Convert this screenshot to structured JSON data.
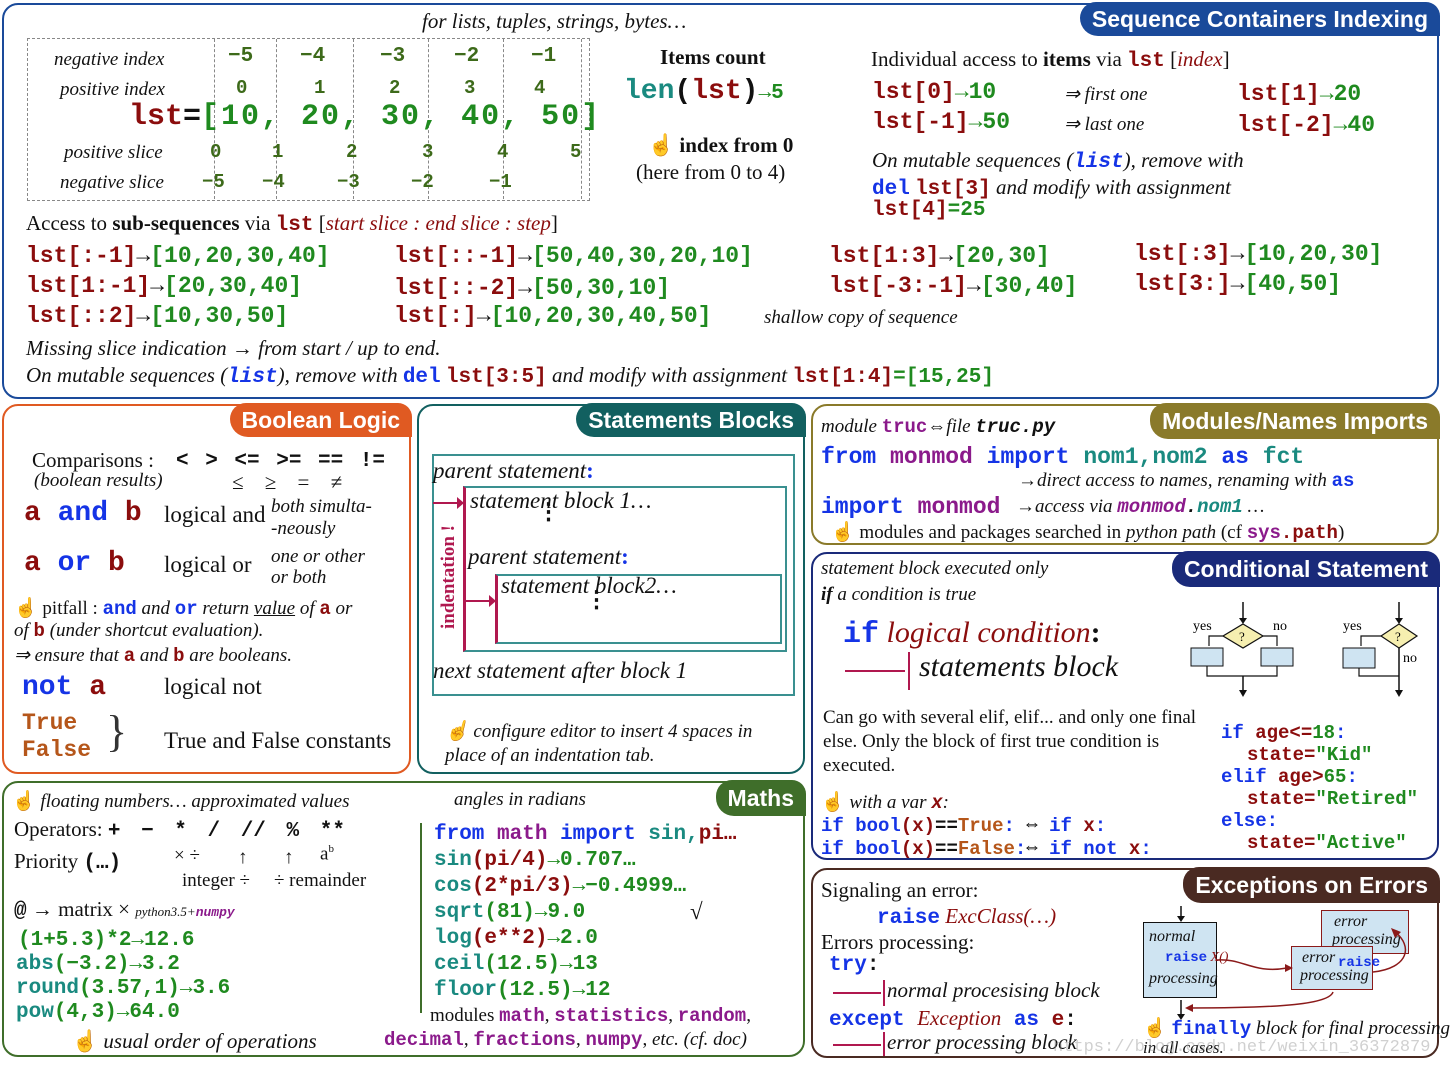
{
  "seq": {
    "title": "Sequence Containers Indexing",
    "subtitle": "for lists, tuples, strings, bytes…",
    "neg_index_label": "negative index",
    "pos_index_label": "positive index",
    "pos_slice_label": "positive slice",
    "neg_slice_label": "negative slice",
    "neg_index": [
      "−5",
      "−4",
      "−3",
      "−2",
      "−1"
    ],
    "pos_index": [
      "0",
      "1",
      "2",
      "3",
      "4"
    ],
    "pos_slice": [
      "0",
      "1",
      "2",
      "3",
      "4",
      "5"
    ],
    "neg_slice": [
      "−5",
      "−4",
      "−3",
      "−2",
      "−1"
    ],
    "lst_name": "lst",
    "lst_eq": "=",
    "lst_values": "[10, 20, 30, 40, 50]",
    "items_count_title": "Items count",
    "len_fn": "len",
    "len_open": "(",
    "len_arg": "lst",
    "len_close": ")",
    "len_result": "→5",
    "index_from_0": "index from 0",
    "index_range": "(here from 0 to 4)",
    "individual_access_prefix": "Individual access to ",
    "individual_access_bold": "items",
    "individual_access_via": " via ",
    "individual_access_index": "index",
    "access": [
      {
        "expr": "lst[0]",
        "res": "→10",
        "note": "⇒ first one"
      },
      {
        "expr": "lst[-1]",
        "res": "→50",
        "note": "⇒ last one"
      },
      {
        "expr": "lst[1]",
        "res": "→20"
      },
      {
        "expr": "lst[-2]",
        "res": "→40"
      }
    ],
    "mutable_text1": "On mutable sequences (",
    "mutable_list": "list",
    "mutable_text2": "), remove with",
    "del_kw": "del",
    "del_expr": "lst[3]",
    "modify_text": " and modify with assignment",
    "assign_expr": "lst[4]",
    "assign_val": "=25",
    "subseq_prefix": "Access to ",
    "subseq_bold": "sub-sequences",
    "subseq_via": " via ",
    "subseq_syntax": "start slice : end slice : step",
    "slices": [
      {
        "expr": "lst[:-1]",
        "res": "[10,20,30,40]"
      },
      {
        "expr": "lst[1:-1]",
        "res": "[20,30,40]"
      },
      {
        "expr": "lst[::2]",
        "res": "[10,30,50]"
      },
      {
        "expr": "lst[::-1]",
        "res": "[50,40,30,20,10]"
      },
      {
        "expr": "lst[::-2]",
        "res": "[50,30,10]"
      },
      {
        "expr": "lst[:]",
        "res": "[10,20,30,40,50]"
      },
      {
        "expr": "lst[1:3]",
        "res": "[20,30]"
      },
      {
        "expr": "lst[-3:-1]",
        "res": "[30,40]"
      },
      {
        "expr": "lst[:3]",
        "res": "[10,20,30]"
      },
      {
        "expr": "lst[3:]",
        "res": "[40,50]"
      }
    ],
    "shallow_copy": "shallow copy of sequence",
    "missing_slice": "Missing slice indication → from start / up to end.",
    "mutable2_text1": "On mutable sequences (",
    "mutable2_list": "list",
    "mutable2_text2": "), remove with ",
    "mutable2_del": "del",
    "mutable2_del_expr": "lst[3:5]",
    "mutable2_text3": " and modify with assignment ",
    "mutable2_assign": "lst[1:4]",
    "mutable2_val": "=[15,25]"
  },
  "bool": {
    "title": "Boolean Logic",
    "comparisons_label": "Comparisons :",
    "comparisons_ops": "< > <= >= == !=",
    "boolean_results": "(boolean results)",
    "math_ops": "≤  ≥  =  ≠",
    "and_a": "a",
    "and_kw": "and",
    "and_b": "b",
    "and_desc": "logical and",
    "and_note1": "both simulta-",
    "and_note2": "-neously",
    "or_a": "a",
    "or_kw": "or",
    "or_b": "b",
    "or_desc": "logical or",
    "or_note1": "one or other",
    "or_note2": "or both",
    "pitfall_label": "pitfall :",
    "pitfall_and": "and",
    "pitfall_mid": " and ",
    "pitfall_or": "or",
    "pitfall_return": " return ",
    "pitfall_value": "value",
    "pitfall_of": " of ",
    "pitfall_a": "a",
    "pitfall_or2": " or",
    "pitfall_line2_of": "of ",
    "pitfall_line2_b": "b",
    "pitfall_line2_rest": " (under shortcut evaluation).",
    "ensure_prefix": "⇒ ensure that ",
    "ensure_a": "a",
    "ensure_and": " and ",
    "ensure_b": "b",
    "ensure_rest": " are booleans.",
    "not_kw": "not",
    "not_a": "a",
    "not_desc": "logical not",
    "true_kw": "True",
    "false_kw": "False",
    "constants_desc": "True and False constants"
  },
  "blocks": {
    "title": "Statements Blocks",
    "parent1": "parent statement",
    "colon": ":",
    "block1": "statement block 1…",
    "parent2": "parent statement",
    "block2": "statement block2…",
    "next": "next statement after block 1",
    "indentation": "indentation !",
    "tip": "configure editor to insert 4 spaces in place of an indentation tab."
  },
  "modules": {
    "title": "Modules/Names Imports",
    "module_label": "module",
    "module_name": "truc",
    "file_label": "⇔file",
    "file_name": "truc.py",
    "from_kw": "from",
    "monmod": "monmod",
    "import_kw": "import",
    "names": "nom1,nom2",
    "as_kw": "as",
    "fct": "fct",
    "direct_access": "→direct access to names, renaming with ",
    "direct_as": "as",
    "import2_kw": "import",
    "import2_mod": "monmod",
    "access_via": "→access via ",
    "access_mod": "monmod",
    "access_dot": ".",
    "access_name": "nom1",
    "access_ellipsis": " …",
    "search_text": "modules and packages searched in ",
    "search_path": "python path",
    "search_cf": " (cf ",
    "sys": "sys",
    "path": ".path",
    "close": ")"
  },
  "cond": {
    "title": "Conditional Statement",
    "intro1": "statement block executed only",
    "intro2_if": "if",
    "intro2_rest": " a condition is true",
    "if_kw": "if",
    "logical_condition": "logical condition",
    "colon": ":",
    "statements_block": "statements block",
    "yes": "yes",
    "no": "no",
    "question": "?",
    "elif_text": "Can go with several elif, elif... and only one final else. Only the block of first true condition is executed.",
    "with_var": "with a var ",
    "var_x": "x",
    "with_colon": ":",
    "example": [
      {
        "kw": "if",
        "var": "age<=",
        "num": "18",
        "end": ":"
      },
      {
        "kw": "",
        "var": "state=",
        "num": "\"Kid\"",
        "end": ""
      },
      {
        "kw": "elif",
        "var": "age>",
        "num": "65",
        "end": ":"
      },
      {
        "kw": "",
        "var": "state=",
        "num": "\"Retired\"",
        "end": ""
      },
      {
        "kw": "else",
        "var": "",
        "num": "",
        "end": ":"
      },
      {
        "kw": "",
        "var": "state=",
        "num": "\"Active\"",
        "end": ""
      }
    ],
    "bool_line1": {
      "a": "if bool",
      "x": "(x)",
      "eq": "==",
      "val": "True",
      "c": ":",
      "eqv": "⇔",
      "b": "if",
      "bx": "x",
      "bc": ":"
    },
    "bool_line2": {
      "a": "if bool",
      "x": "(x)",
      "eq": "==",
      "val": "False",
      "c": ":",
      "eqv": "⇔",
      "b": "if not",
      "bx": "x",
      "bc": ":"
    }
  },
  "maths": {
    "title": "Maths",
    "floating": "floating numbers… approximated values",
    "operators_label": "Operators:",
    "operators": "+ − * / // % **",
    "priority_label": "Priority",
    "priority_parens": "(…)",
    "mul_div": "× ÷",
    "power": "a",
    "power_sup": "b",
    "integer_div": "integer ÷",
    "remainder": "÷ remainder",
    "matrix_at": "@",
    "matrix_text": " → matrix ×",
    "matrix_note": "python3.5+",
    "matrix_numpy": "numpy",
    "examples": [
      {
        "fn": "",
        "args": "(1+5.3)*2",
        "res": "→12.6"
      },
      {
        "fn": "abs",
        "args": "(−3.2)",
        "res": "→3.2"
      },
      {
        "fn": "round",
        "args": "(3.57,1)",
        "res": "→3.6"
      },
      {
        "fn": "pow",
        "args": "(4,3)",
        "res": "→64.0"
      }
    ],
    "usual_order": "usual order of operations",
    "angles": "angles in radians",
    "from_kw": "from",
    "math_mod": "math",
    "import_kw": "import",
    "import_names": "sin,",
    "import_pi": "pi…",
    "funcs": [
      {
        "fn": "sin",
        "args": "(pi/4)",
        "res": "→0.707…"
      },
      {
        "fn": "cos",
        "args": "(2*pi/3)",
        "res": "→−0.4999…"
      },
      {
        "fn": "sqrt",
        "args": "(81)",
        "res": "→9.0"
      },
      {
        "fn": "log",
        "args": "(e**2)",
        "res": "→2.0"
      },
      {
        "fn": "ceil",
        "args": "(12.5)",
        "res": "→13"
      },
      {
        "fn": "floor",
        "args": "(12.5)",
        "res": "→12"
      }
    ],
    "sqrt_symbol": "√",
    "modules_label": "modules ",
    "mods1": [
      "math",
      "statistics",
      "random"
    ],
    "mods2": [
      "decimal",
      "fractions",
      "numpy"
    ],
    "etc": "etc. (cf. doc)"
  },
  "exc": {
    "title": "Exceptions on Errors",
    "signaling": "Signaling an error:",
    "raise_kw": "raise",
    "exc_class": "ExcClass(…)",
    "errors_processing": "Errors processing:",
    "try_kw": "try",
    "try_colon": ":",
    "normal_block": "normal procesising block",
    "except_kw": "except",
    "exception": "Exception",
    "as_kw": "as",
    "e_var": "e",
    "except_colon": ":",
    "error_block": "error processing block",
    "diag_normal": "normal",
    "diag_raise": "raise",
    "diag_x": "X()",
    "diag_processing": "processing",
    "diag_error": "error",
    "diag_error_processing": "processing",
    "finally_kw": "finally",
    "finally_text": " block for final processing",
    "finally_text2": "in all cases.",
    "watermark": "https://blog.csdn.net/weixin_36372879"
  },
  "colors": {
    "seq": "#1a4a9a",
    "bool": "#e05a22",
    "blocks": "#126060",
    "modules": "#8a7a2a",
    "cond": "#1a2a7a",
    "maths": "#3f6e2a",
    "exc": "#4a2a22"
  }
}
